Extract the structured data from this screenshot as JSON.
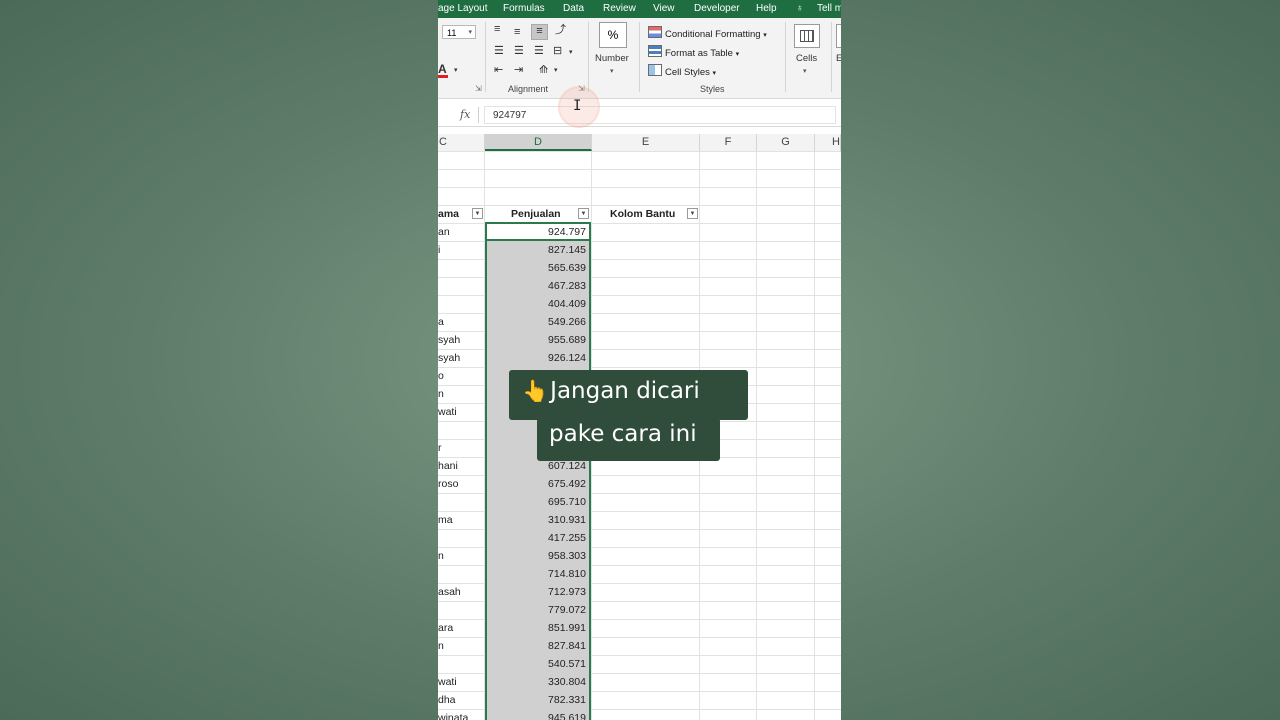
{
  "menu": {
    "items": [
      "age Layout",
      "Formulas",
      "Data",
      "Review",
      "View",
      "Developer",
      "Help",
      "Tell m"
    ]
  },
  "ribbon": {
    "font_size": "11",
    "font_color_letter": "A",
    "alignment_label": "Alignment",
    "number_label": "Number",
    "number_symbol": "%",
    "styles": {
      "label": "Styles",
      "conditional_formatting": "Conditional Formatting",
      "format_as_table": "Format as Table",
      "cell_styles": "Cell Styles"
    },
    "cells_label": "Cells",
    "edge_label": "E"
  },
  "formula_bar": {
    "fx": "fx",
    "value": "924797"
  },
  "columns": [
    "C",
    "D",
    "E",
    "F",
    "G",
    "H"
  ],
  "selected_column": "D",
  "table": {
    "headers": {
      "nama": "ama",
      "penjualan": "Penjualan",
      "kolom_bantu": "Kolom Bantu"
    },
    "names": [
      "an",
      "i",
      "",
      "",
      "",
      "a",
      "syah",
      "syah",
      "o",
      "n",
      "wati",
      "",
      "r",
      "hani",
      "roso",
      "",
      "ma",
      "",
      "n",
      "",
      "asah",
      "",
      "ara",
      "n",
      "",
      "wati",
      "dha",
      "winata"
    ],
    "values": [
      "924.797",
      "827.145",
      "565.639",
      "467.283",
      "404.409",
      "549.266",
      "955.689",
      "926.124",
      "",
      "",
      "",
      "",
      "",
      "607.124",
      "675.492",
      "695.710",
      "310.931",
      "417.255",
      "958.303",
      "714.810",
      "712.973",
      "779.072",
      "851.991",
      "827.841",
      "540.571",
      "330.804",
      "782.331",
      "945.619"
    ]
  },
  "overlay": {
    "pointer": "👆",
    "line1": "Jangan dicari",
    "line2": "pake cara ini"
  }
}
